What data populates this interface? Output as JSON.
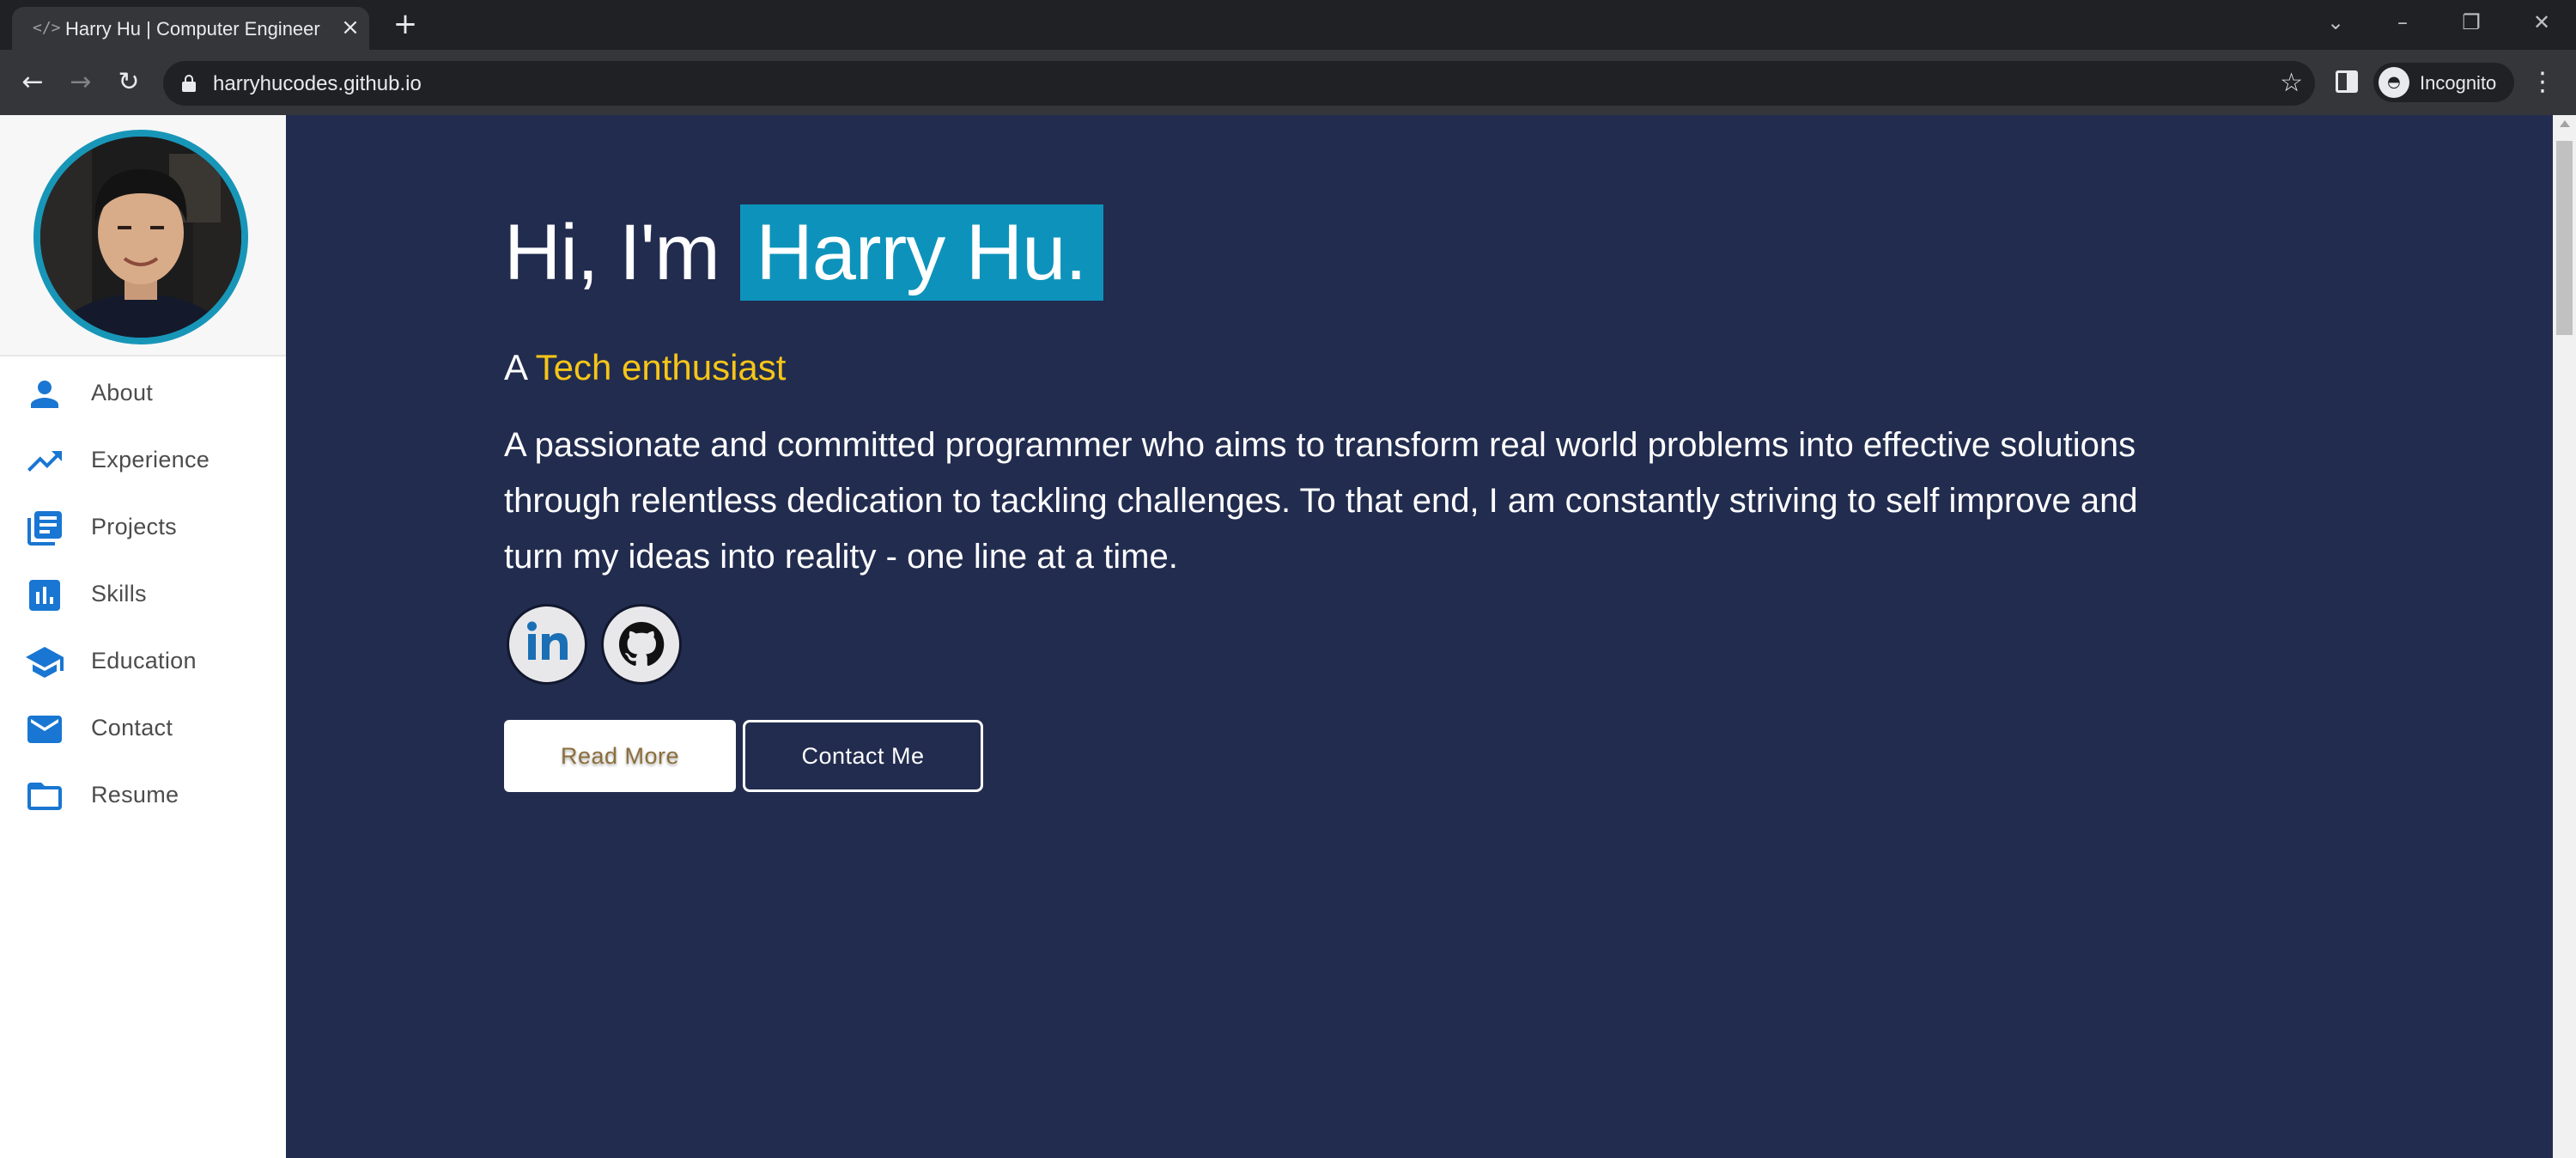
{
  "browser": {
    "tab_title": "Harry Hu | Computer Engineer",
    "tab_favicon": "</>",
    "url": "harryhucodes.github.io",
    "profile_label": "Incognito"
  },
  "sidebar": {
    "avatar_alt": "profile photo",
    "items": [
      {
        "label": "About",
        "icon": "person-icon"
      },
      {
        "label": "Experience",
        "icon": "trending-up-icon"
      },
      {
        "label": "Projects",
        "icon": "library-books-icon"
      },
      {
        "label": "Skills",
        "icon": "bar-chart-icon"
      },
      {
        "label": "Education",
        "icon": "school-icon"
      },
      {
        "label": "Contact",
        "icon": "mail-icon"
      },
      {
        "label": "Resume",
        "icon": "folder-icon"
      }
    ]
  },
  "hero": {
    "greeting": "Hi, I'm ",
    "name": "Harry Hu.",
    "tagline_prefix": "A ",
    "tagline_accent": "Tech enthusiast",
    "bio": "A passionate and committed programmer who aims to transform real world problems into effective solutions through relentless dedication to tackling challenges. To that end, I am constantly striving to self improve and turn my ideas into reality - one line at a time.",
    "read_more_label": "Read More",
    "contact_label": "Contact Me"
  },
  "colors": {
    "hero_bg": "#222c4f",
    "name_highlight": "#0d93bb",
    "accent": "#f5c518",
    "sidebar_icon": "#1976d2",
    "avatar_ring": "#1896b8"
  }
}
